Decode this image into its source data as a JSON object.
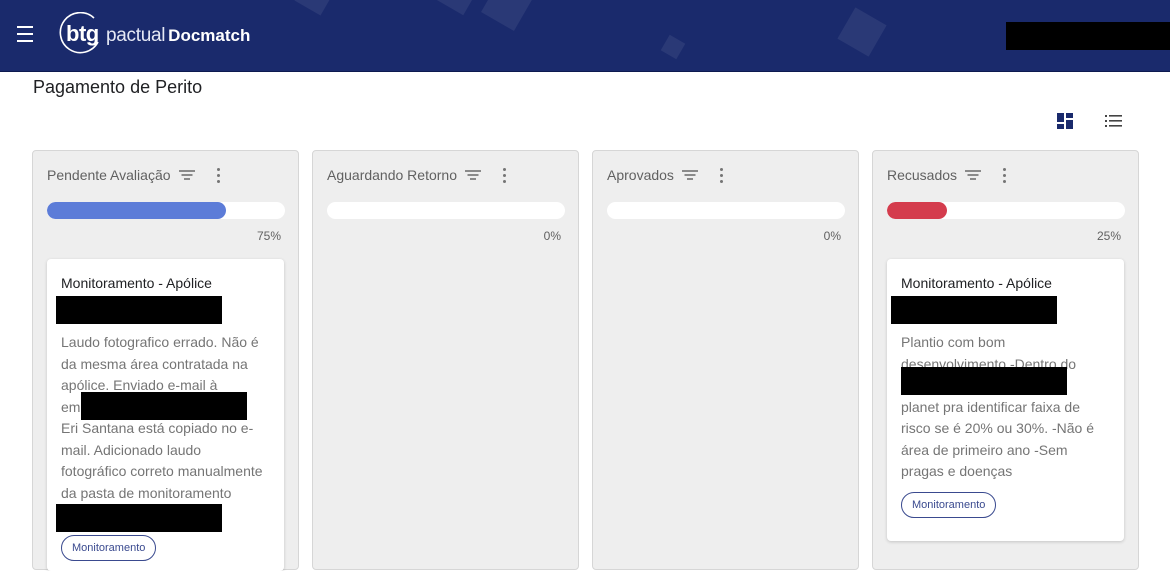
{
  "header": {
    "logo_btg": "btg",
    "logo_pactual": "pactual",
    "logo_docmatch": "Docmatch"
  },
  "page": {
    "title": "Pagamento de Perito"
  },
  "view_toggles": [
    {
      "name": "grid-view-icon",
      "active": true
    },
    {
      "name": "list-view-icon",
      "active": false
    }
  ],
  "columns": [
    {
      "title": "Pendente Avaliação",
      "progress": 75,
      "progress_label": "75%",
      "color": "#5c7cd8",
      "cards": [
        {
          "title": "Monitoramento - Apólice",
          "description": "Laudo fotografico errado. Não é\nda mesma área contratada na\napólice. Enviado e-mail à\nem                                  22.\nEri Santana está copiado no e-\nmail. Adicionado laudo\nfotográfico correto manualmente\nda pasta de monitoramento",
          "tag": "Monitoramento"
        }
      ]
    },
    {
      "title": "Aguardando Retorno",
      "progress": 0,
      "progress_label": "0%",
      "color": "#5c7cd8",
      "cards": []
    },
    {
      "title": "Aprovados",
      "progress": 0,
      "progress_label": "0%",
      "color": "#5c7cd8",
      "cards": []
    },
    {
      "title": "Recusados",
      "progress": 25,
      "progress_label": "25%",
      "color": "#d43c4d",
      "cards": [
        {
          "title": "Monitoramento - Apólice",
          "description": "Plantio com bom\ndesenvolvimento -Dentro do\n                                   ar\nplanet pra identificar faixa de\nrisco se é 20% ou 30%. -Não é\nárea de primeiro ano -Sem\npragas e doenças",
          "tag": "Monitoramento"
        }
      ]
    }
  ]
}
